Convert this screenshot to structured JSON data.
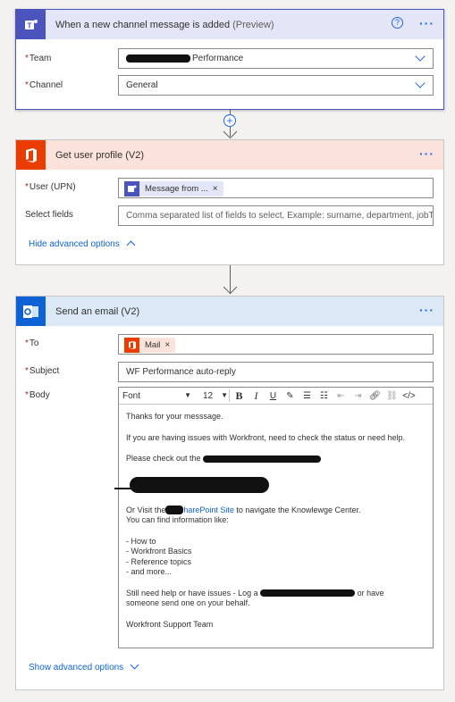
{
  "card1": {
    "title": "When a new channel message is added",
    "title_sub": "(Preview)",
    "team_label": "Team",
    "team_value": "Performance",
    "channel_label": "Channel",
    "channel_value": "General",
    "header_color": "#e3e6f7",
    "border_color": "#4b53bc",
    "icon": "teams-icon"
  },
  "card2": {
    "title": "Get user profile (V2)",
    "user_label": "User (UPN)",
    "user_token": "Message from ...",
    "select_label": "Select fields",
    "select_placeholder": "Comma separated list of fields to select, Example: surname, department, jobTitl",
    "advanced_link": "Hide advanced options",
    "header_color": "#fbe3db",
    "icon": "office-icon"
  },
  "card3": {
    "title": "Send an email (V2)",
    "to_label": "To",
    "to_token": "Mail",
    "subject_label": "Subject",
    "subject_value": "WF Performance auto-reply",
    "body_label": "Body",
    "font_label": "Font",
    "size_label": "12",
    "advanced_link": "Show advanced options",
    "header_color": "#dbe9f7",
    "icon": "outlook-icon",
    "body": {
      "l1": "Thanks for your messsage.",
      "l2": "If you are having issues with Workfront, need to check the status or need help.",
      "l3": "Please check out the",
      "l4a": "Or Visit the",
      "l4link": "harePoint Site",
      "l4b": " to navigate the Knowlewge Center.",
      "l5": "You can find information like:",
      "l6": "- How to",
      "l7": "- Workfront Basics",
      "l8": "- Reference topics",
      "l9": "- and more...",
      "l10a": "Still need help or have issues - Log a",
      "l10b": "or have",
      "l11": "someone send one on your behalf.",
      "l12": "Workfront Support Team"
    }
  }
}
